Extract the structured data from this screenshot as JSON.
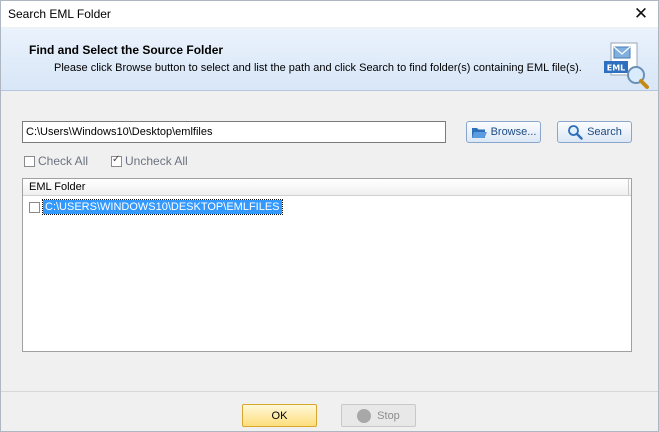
{
  "window": {
    "title": "Search EML Folder",
    "close_glyph": "✕"
  },
  "header": {
    "title": "Find and Select the Source Folder",
    "subtitle": "Please click Browse button to select and list the path and click Search to find folder(s) containing EML file(s).",
    "icon": "eml-file-search-icon",
    "icon_label": "EML"
  },
  "path": {
    "value": "C:\\Users\\Windows10\\Desktop\\emlfiles"
  },
  "buttons": {
    "browse": "Browse...",
    "search": "Search",
    "ok": "OK",
    "stop": "Stop"
  },
  "checks": {
    "check_all": "Check All",
    "uncheck_all": "Uncheck All",
    "uncheck_all_checked": true
  },
  "list": {
    "column": "EML Folder",
    "rows": [
      {
        "path": "C:\\USERS\\WINDOWS10\\DESKTOP\\EMLFILES",
        "checked": false,
        "selected": true
      }
    ]
  },
  "colors": {
    "selection": "#3399ff",
    "ok_fill": "#fdde7d",
    "link_text": "#1b4a84",
    "header_bg": "#dde9f8"
  }
}
